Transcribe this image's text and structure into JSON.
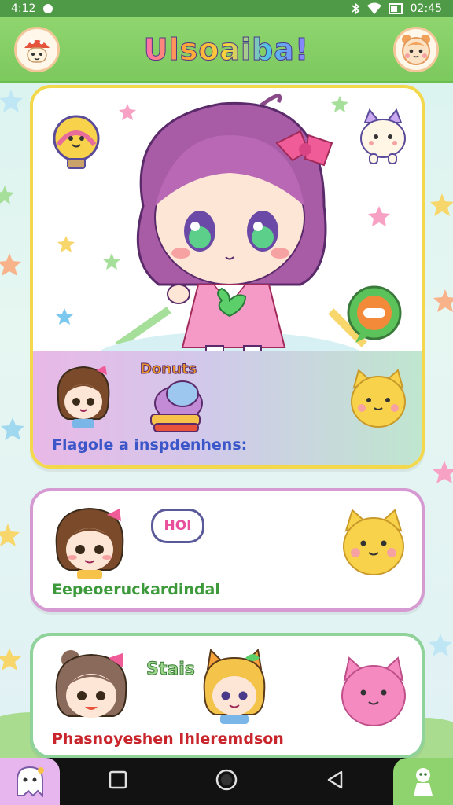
{
  "status_bar": {
    "time_left": "4:12",
    "time_right": "02:45"
  },
  "header": {
    "title": "Ulsoaiba!",
    "left_icon": "mushroom-mascot-icon",
    "right_icon": "hamster-face-icon"
  },
  "cards": [
    {
      "id": "hero",
      "label": "Flagole a inspdenhens:",
      "sticker_text": "Donuts",
      "label_color": "#3a56c8"
    },
    {
      "id": "second",
      "label": "Eepeoeruckardindal",
      "bubble_text": "HOI",
      "label_color": "#3d9a3a"
    },
    {
      "id": "third",
      "label": "Phasnoyeshen Ihleremdson",
      "sticker_text": "Stais",
      "label_color": "#c8252c"
    }
  ],
  "nav": {
    "back": "back-icon",
    "home": "home-icon",
    "recents": "recents-icon"
  },
  "colors": {
    "header_green": "#7cc95e",
    "hero_border": "#f2d84a",
    "card2_border": "#d69ad2",
    "card3_border": "#8fd29a"
  }
}
